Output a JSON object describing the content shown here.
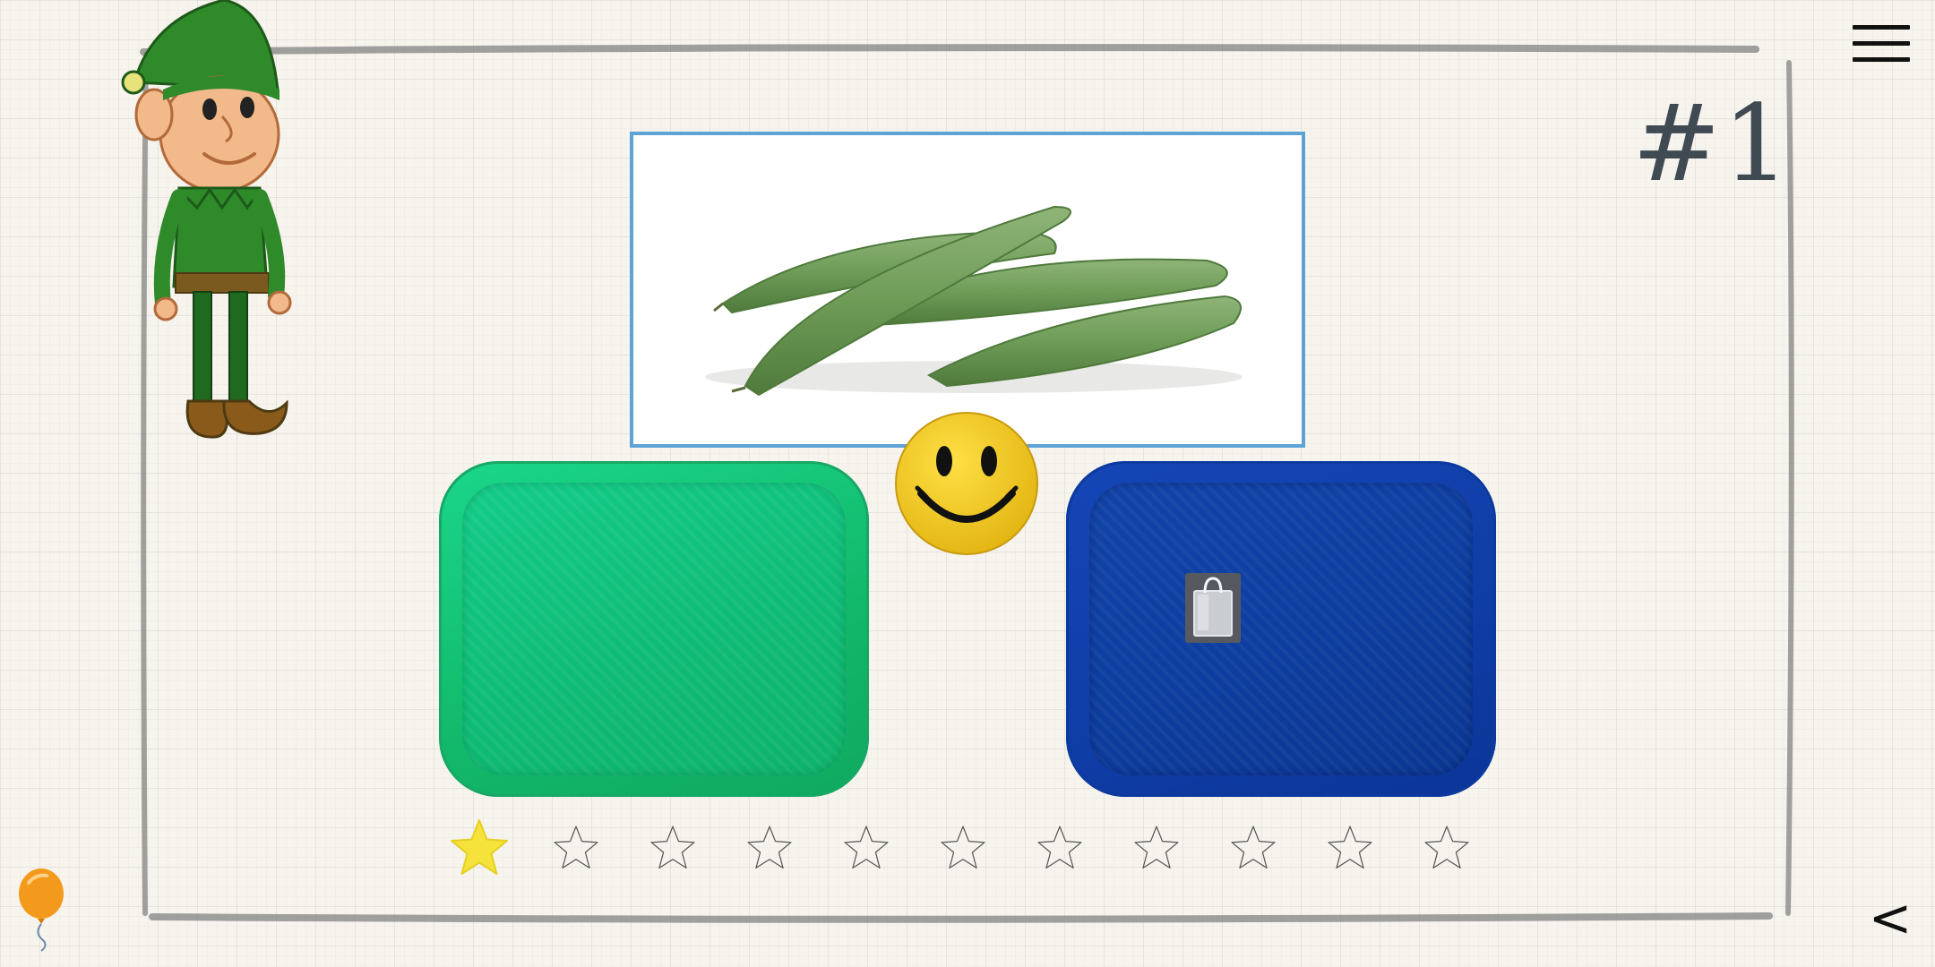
{
  "game": {
    "level_label": "#1",
    "menu_icon": "hamburger-icon",
    "back_glyph": "<",
    "progress": {
      "total_stars": 11,
      "earned_stars": 1
    }
  },
  "prompt_picture": {
    "subject": "snow pea pods",
    "frame_color": "#5ea3d6"
  },
  "trays": [
    {
      "name": "green-tray",
      "color": "#12b86a"
    },
    {
      "name": "blue-tray",
      "color": "#0f3da6"
    }
  ],
  "colors": {
    "star_filled": "#f5e23b",
    "star_outline": "#555555",
    "smiley": "#f2c81a",
    "balloon": "#f39a1c",
    "frame": "#8f8f8f"
  }
}
